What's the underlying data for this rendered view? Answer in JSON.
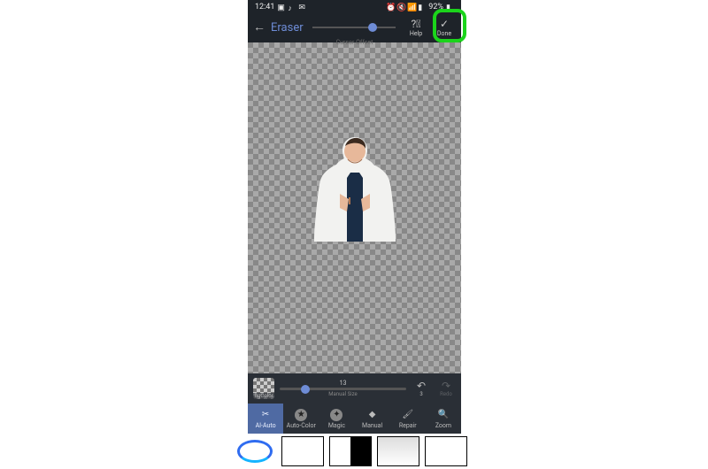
{
  "status": {
    "time": "12:41",
    "battery": "92%"
  },
  "topbar": {
    "title": "Eraser",
    "help": "Help",
    "done": "Done",
    "cursor_offset": "Cursor Offset"
  },
  "controls": {
    "bgcolor": "BgColor",
    "slider_value": "13",
    "slider_label": "Manual Size",
    "undo_count": "3",
    "redo": "Redo"
  },
  "tools": {
    "ai_auto": "AI-Auto",
    "auto_color": "Auto-Color",
    "magic": "Magic",
    "manual": "Manual",
    "repair": "Repair",
    "zoom": "Zoom"
  }
}
